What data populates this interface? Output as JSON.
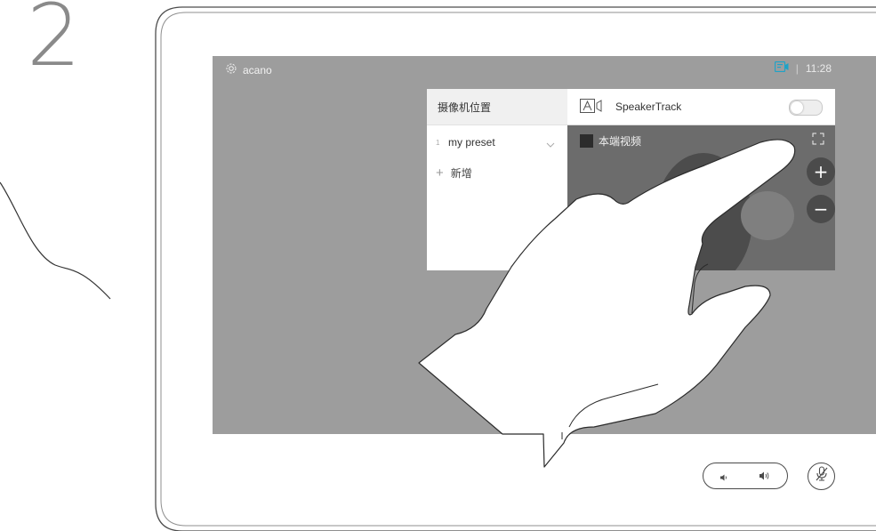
{
  "step": {
    "number": "2"
  },
  "topbar": {
    "device_name": "acano",
    "time": "11:28",
    "separator": "|"
  },
  "camera_panel": {
    "presets_header": "摄像机位置",
    "presets": [
      {
        "index": "1",
        "label": "my preset"
      }
    ],
    "add_label": "新增",
    "speakertrack_label": "SpeakerTrack",
    "speakertrack_enabled": false,
    "local_video_label": "本端视频",
    "zoom_in": "+",
    "zoom_out": "−",
    "pan_up": "^"
  },
  "colors": {
    "screen_bg": "#9d9d9d",
    "video_bg": "#6c6c6c",
    "accent_camera_icon": "#1ea3c8",
    "outline": "#555555"
  },
  "icons": [
    "gear-icon",
    "camera-icon",
    "speakertrack-icon",
    "chevron-down-icon",
    "plus-icon",
    "fullscreen-icon",
    "volume-down-icon",
    "volume-up-icon",
    "mic-muted-icon"
  ]
}
